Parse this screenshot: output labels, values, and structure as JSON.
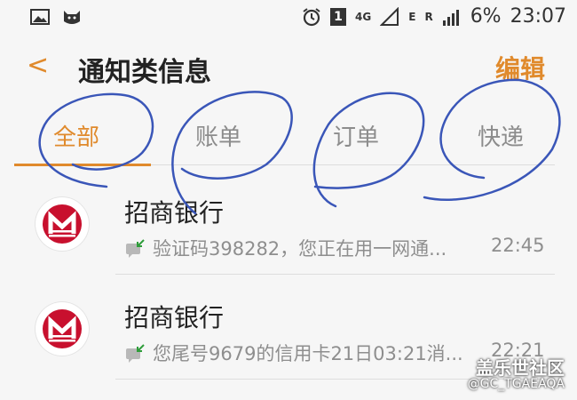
{
  "statusbar": {
    "sim_badge": "1",
    "network": "4G",
    "e_label": "E",
    "r_label": "R",
    "battery": "6%",
    "time": "23:07",
    "left_icons": [
      "image-icon",
      "cat-icon"
    ],
    "right_icons": [
      "alarm-icon",
      "signal-icon",
      "signal-icon-2"
    ]
  },
  "header": {
    "back_glyph": "<",
    "title": "通知类信息",
    "edit_label": "编辑"
  },
  "tabs": [
    {
      "label": "全部",
      "active": true
    },
    {
      "label": "账单",
      "active": false
    },
    {
      "label": "订单",
      "active": false
    },
    {
      "label": "快递",
      "active": false
    }
  ],
  "messages": [
    {
      "sender": "招商银行",
      "snippet": "验证码398282，您正在用一网通...",
      "time": "22:45"
    },
    {
      "sender": "招商银行",
      "snippet": "您尾号9679的信用卡21日03:21消...",
      "time": "22:21"
    }
  ],
  "watermark": {
    "line1": "盖乐世社区",
    "line2": "@GC_TGAEAQA"
  },
  "colors": {
    "accent": "#e08a2c",
    "scribble": "#3a56b8",
    "logo_red": "#c8102e"
  }
}
